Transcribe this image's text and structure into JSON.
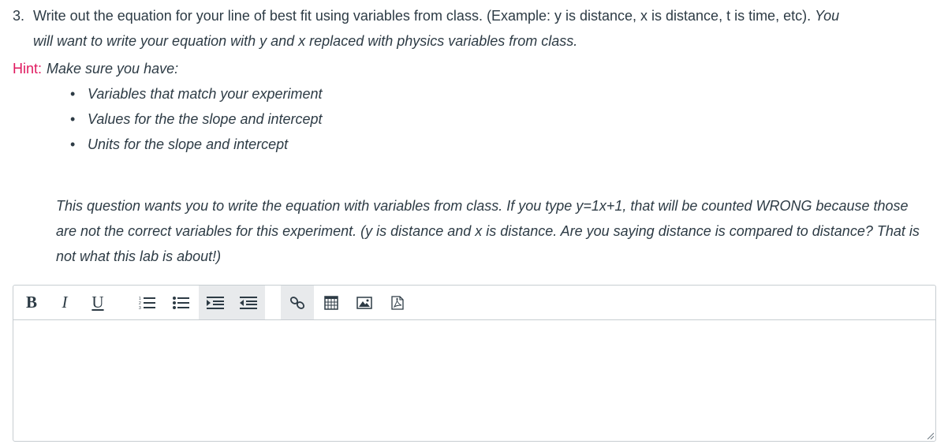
{
  "question": {
    "number": "3.",
    "text": "Write out the equation for your line of best fit using variables from class. (Example: y is distance, x is distance, t is time, etc).",
    "italic_first": "You",
    "italic_rest": "will want to write your equation with y and x replaced with physics variables from class."
  },
  "hint": {
    "label": "Hint:",
    "text": "Make sure you have:",
    "items": [
      "Variables that match your experiment",
      "Values for the the slope and intercept",
      "Units for the slope and intercept"
    ]
  },
  "note": {
    "text": "This question wants you to write the equation with variables from class. If you type y=1x+1, that will be counted WRONG because those are not the correct variables for this experiment. (y is distance and x is distance. Are you saying distance is compared to distance? That is not what this lab is about!)"
  },
  "editor": {
    "toolbar": {
      "bold_label": "B",
      "italic_label": "I",
      "underline_label": "U",
      "icons": [
        "numbered-list-icon",
        "bullet-list-icon",
        "indent-icon",
        "outdent-icon",
        "link-icon",
        "table-icon",
        "image-icon",
        "pdf-icon"
      ]
    },
    "content": ""
  },
  "colors": {
    "text": "#2d3b45",
    "hint_label": "#e0195f",
    "border": "#c7cdd1",
    "toolbar_shade": "#e8eaec"
  }
}
